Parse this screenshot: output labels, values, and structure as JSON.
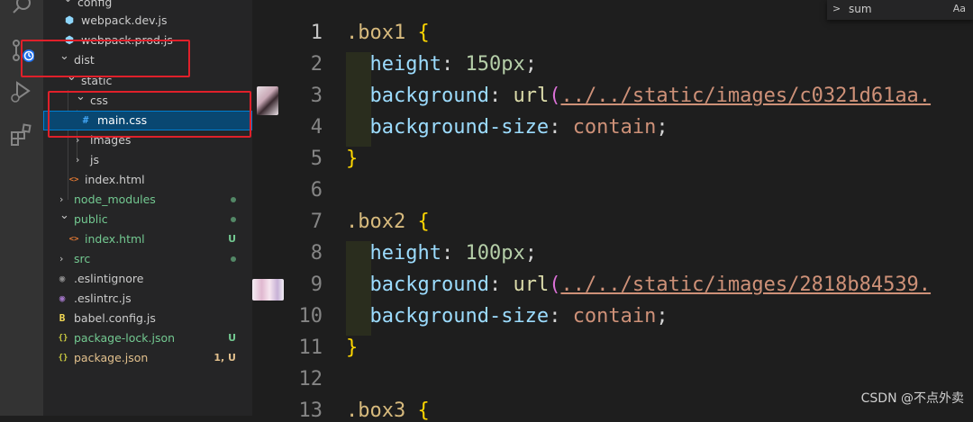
{
  "explorer": {
    "items": [
      {
        "label": "config",
        "kind": "folder",
        "open": true,
        "status": "",
        "dot": false,
        "color": "#cccccc"
      },
      {
        "label": "webpack.dev.js",
        "kind": "file",
        "icon": "webpack",
        "status": "",
        "dot": false,
        "color": "#cccccc"
      },
      {
        "label": "webpack.prod.js",
        "kind": "file",
        "icon": "webpack",
        "status": "",
        "dot": false,
        "color": "#cccccc"
      },
      {
        "label": "dist",
        "kind": "folder",
        "open": true,
        "status": "",
        "dot": false,
        "color": "#cccccc"
      },
      {
        "label": "static",
        "kind": "folder",
        "open": true,
        "status": "",
        "dot": false,
        "color": "#cccccc"
      },
      {
        "label": "css",
        "kind": "folder",
        "open": true,
        "status": "",
        "dot": false,
        "color": "#cccccc"
      },
      {
        "label": "main.css",
        "kind": "file",
        "icon": "css",
        "status": "",
        "dot": false,
        "color": "#ffffff",
        "selected": true
      },
      {
        "label": "images",
        "kind": "folder",
        "open": false,
        "status": "",
        "dot": false,
        "color": "#cccccc"
      },
      {
        "label": "js",
        "kind": "folder",
        "open": false,
        "status": "",
        "dot": false,
        "color": "#cccccc"
      },
      {
        "label": "index.html",
        "kind": "file",
        "icon": "html",
        "status": "",
        "dot": false,
        "color": "#cccccc"
      },
      {
        "label": "node_modules",
        "kind": "folder",
        "open": false,
        "status": "",
        "dot": true,
        "color": "#73c991"
      },
      {
        "label": "public",
        "kind": "folder",
        "open": true,
        "status": "",
        "dot": true,
        "color": "#73c991"
      },
      {
        "label": "index.html",
        "kind": "file",
        "icon": "html",
        "status": "U",
        "dot": false,
        "color": "#73c991"
      },
      {
        "label": "src",
        "kind": "folder",
        "open": false,
        "status": "",
        "dot": true,
        "color": "#73c991"
      },
      {
        "label": ".eslintignore",
        "kind": "file",
        "icon": "eslintignore",
        "status": "",
        "dot": false,
        "color": "#cccccc"
      },
      {
        "label": ".eslintrc.js",
        "kind": "file",
        "icon": "eslint",
        "status": "",
        "dot": false,
        "color": "#cccccc"
      },
      {
        "label": "babel.config.js",
        "kind": "file",
        "icon": "babel",
        "status": "",
        "dot": false,
        "color": "#cccccc"
      },
      {
        "label": "package-lock.json",
        "kind": "file",
        "icon": "json",
        "status": "U",
        "dot": false,
        "color": "#73c991"
      },
      {
        "label": "package.json",
        "kind": "file",
        "icon": "json",
        "status": "1, U",
        "dot": false,
        "color": "#e2c08d"
      }
    ]
  },
  "editor": {
    "line_numbers": [
      "1",
      "2",
      "3",
      "4",
      "5",
      "6",
      "7",
      "8",
      "9",
      "10",
      "11",
      "12",
      "13"
    ],
    "active_line": "1",
    "lines": [
      [
        {
          "t": ".box1 ",
          "c": "sel"
        },
        {
          "t": "{",
          "c": "brace"
        }
      ],
      [
        {
          "t": "  ",
          "c": ""
        },
        {
          "t": "height",
          "c": "prop"
        },
        {
          "t": ": ",
          "c": ""
        },
        {
          "t": "150px",
          "c": "num"
        },
        {
          "t": ";",
          "c": ""
        }
      ],
      [
        {
          "t": "  ",
          "c": ""
        },
        {
          "t": "background",
          "c": "prop"
        },
        {
          "t": ": ",
          "c": ""
        },
        {
          "t": "url",
          "c": "fn"
        },
        {
          "t": "(",
          "c": "paren"
        },
        {
          "t": "../../static/images/c0321d61aa.",
          "c": "url"
        }
      ],
      [
        {
          "t": "  ",
          "c": ""
        },
        {
          "t": "background-size",
          "c": "prop"
        },
        {
          "t": ": ",
          "c": ""
        },
        {
          "t": "contain",
          "c": "kw"
        },
        {
          "t": ";",
          "c": ""
        }
      ],
      [
        {
          "t": "}",
          "c": "brace"
        }
      ],
      [],
      [
        {
          "t": ".box2 ",
          "c": "sel"
        },
        {
          "t": "{",
          "c": "brace"
        }
      ],
      [
        {
          "t": "  ",
          "c": ""
        },
        {
          "t": "height",
          "c": "prop"
        },
        {
          "t": ": ",
          "c": ""
        },
        {
          "t": "100px",
          "c": "num"
        },
        {
          "t": ";",
          "c": ""
        }
      ],
      [
        {
          "t": "  ",
          "c": ""
        },
        {
          "t": "background",
          "c": "prop"
        },
        {
          "t": ": ",
          "c": ""
        },
        {
          "t": "url",
          "c": "fn"
        },
        {
          "t": "(",
          "c": "paren"
        },
        {
          "t": "../../static/images/2818b84539.",
          "c": "url"
        }
      ],
      [
        {
          "t": "  ",
          "c": ""
        },
        {
          "t": "background-size",
          "c": "prop"
        },
        {
          "t": ": ",
          "c": ""
        },
        {
          "t": "contain",
          "c": "kw"
        },
        {
          "t": ";",
          "c": ""
        }
      ],
      [
        {
          "t": "}",
          "c": "brace"
        }
      ],
      [],
      [
        {
          "t": ".box3 ",
          "c": "sel"
        },
        {
          "t": "{",
          "c": "brace"
        }
      ]
    ]
  },
  "find_widget": {
    "value": "sum",
    "case_toggle": "Aa"
  },
  "watermark": "CSDN @不点外卖",
  "colors": {
    "accent": "#007fd4",
    "selection": "#094771",
    "annotation_red": "#e0202a",
    "git_untracked": "#73c991",
    "git_modified": "#e2c08d"
  }
}
